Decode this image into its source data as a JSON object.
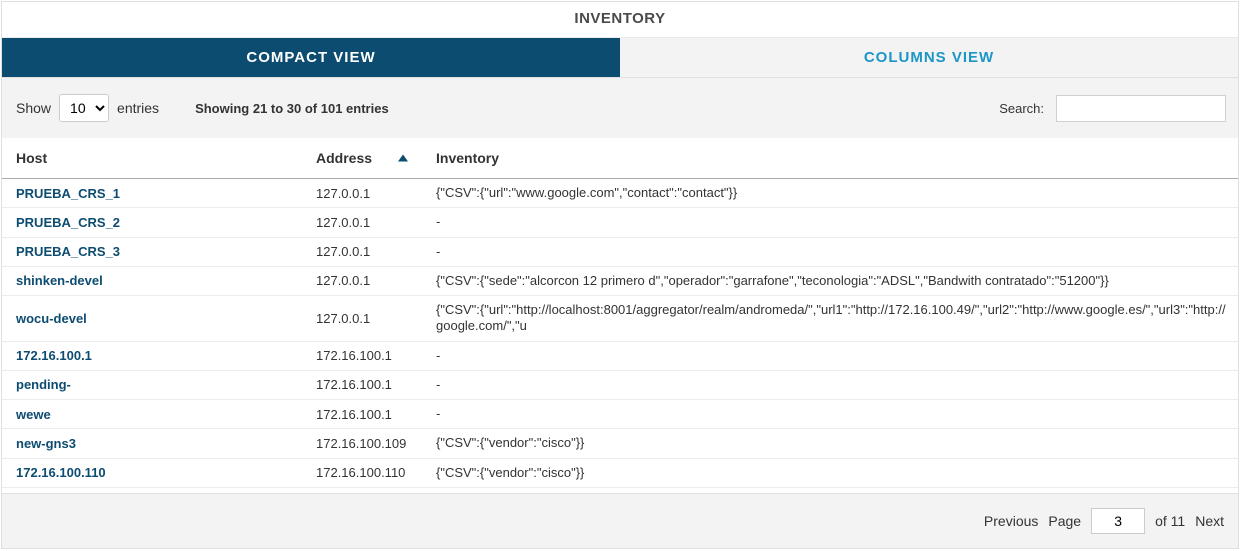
{
  "panel_title": "INVENTORY",
  "tabs": {
    "compact": "COMPACT VIEW",
    "columns": "COLUMNS VIEW"
  },
  "controls": {
    "show_label": "Show",
    "entries_label": "entries",
    "page_size": "10",
    "info": "Showing 21 to 30 of 101 entries",
    "search_label": "Search:",
    "search_value": ""
  },
  "columns": {
    "host": "Host",
    "address": "Address",
    "inventory": "Inventory"
  },
  "rows": [
    {
      "host": "PRUEBA_CRS_1",
      "address": "127.0.0.1",
      "inventory": "{\"CSV\":{\"url\":\"www.google.com\",\"contact\":\"contact\"}}"
    },
    {
      "host": "PRUEBA_CRS_2",
      "address": "127.0.0.1",
      "inventory": "-"
    },
    {
      "host": "PRUEBA_CRS_3",
      "address": "127.0.0.1",
      "inventory": "-"
    },
    {
      "host": "shinken-devel",
      "address": "127.0.0.1",
      "inventory": "{\"CSV\":{\"sede\":\"alcorcon 12 primero d\",\"operador\":\"garrafone\",\"teconologia\":\"ADSL\",\"Bandwith contratado\":\"51200\"}}"
    },
    {
      "host": "wocu-devel",
      "address": "127.0.0.1",
      "inventory": "{\"CSV\":{\"url\":\"http://localhost:8001/aggregator/realm/andromeda/\",\"url1\":\"http://172.16.100.49/\",\"url2\":\"http://www.google.es/\",\"url3\":\"http://google.com/\",\"u"
    },
    {
      "host": "172.16.100.1",
      "address": "172.16.100.1",
      "inventory": "-"
    },
    {
      "host": "pending-",
      "address": "172.16.100.1",
      "inventory": "-"
    },
    {
      "host": "wewe",
      "address": "172.16.100.1",
      "inventory": "-"
    },
    {
      "host": "new-gns3",
      "address": "172.16.100.109",
      "inventory": "{\"CSV\":{\"vendor\":\"cisco\"}}"
    },
    {
      "host": "172.16.100.110",
      "address": "172.16.100.110",
      "inventory": "{\"CSV\":{\"vendor\":\"cisco\"}}"
    }
  ],
  "footer": {
    "previous": "Previous",
    "page_label": "Page",
    "page_value": "3",
    "of_label": "of 11",
    "next": "Next"
  }
}
